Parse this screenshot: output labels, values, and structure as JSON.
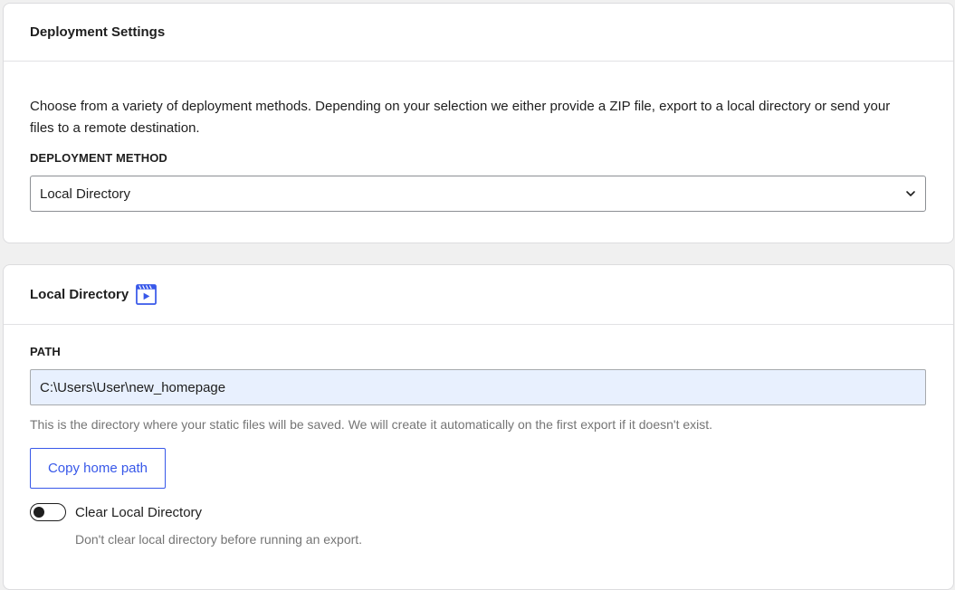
{
  "deployment_settings": {
    "title": "Deployment Settings",
    "intro": "Choose from a variety of deployment methods. Depending on your selection we either provide a ZIP file, export to a local directory or send your files to a remote destination.",
    "method_label": "DEPLOYMENT METHOD",
    "method_selected": "Local Directory"
  },
  "local_directory": {
    "title": "Local Directory",
    "video_icon": "video-icon",
    "path_label": "PATH",
    "path_value": "C:\\Users\\User\\new_homepage",
    "path_help": "This is the directory where your static files will be saved. We will create it automatically on the first export if it doesn't exist.",
    "copy_button": "Copy home path",
    "clear_toggle_label": "Clear Local Directory",
    "clear_toggle_checked": false,
    "clear_toggle_help": "Don't clear local directory before running an export."
  },
  "colors": {
    "accent": "#3858e9",
    "input_fill": "#e8f0fe",
    "help_text": "#757575"
  }
}
